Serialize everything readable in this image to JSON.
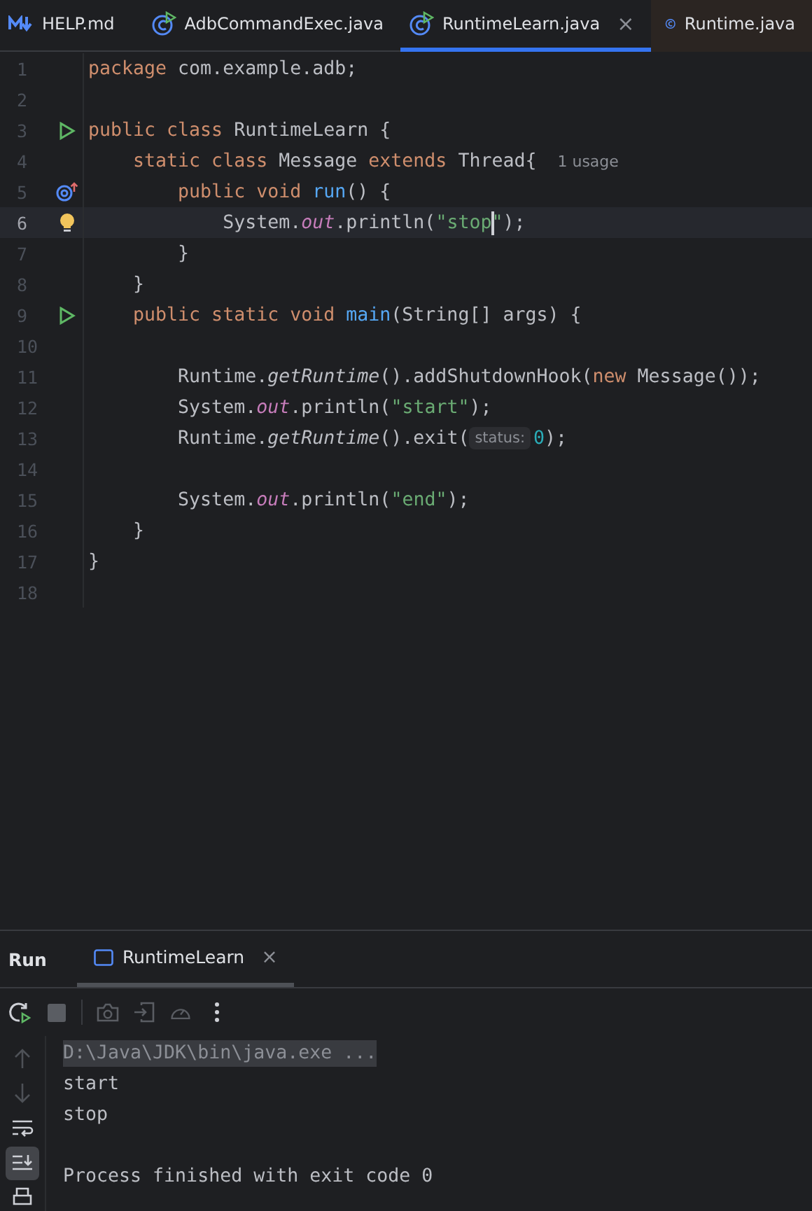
{
  "editor_tabs": [
    {
      "label": "HELP.md",
      "kind": "markdown",
      "selected": false
    },
    {
      "label": "AdbCommandExec.java",
      "kind": "runnable-class",
      "selected": false
    },
    {
      "label": "RuntimeLearn.java",
      "kind": "runnable-class",
      "selected": true,
      "close": "×"
    },
    {
      "label": "Runtime.java",
      "kind": "class",
      "selected": false
    }
  ],
  "code_lines": [
    {
      "number": "1",
      "current": false,
      "parts": [
        {
          "kind": "code",
          "tokens": [
            {
              "kind": "kw",
              "text": "package "
            },
            {
              "kind": "plain",
              "text": "com.example.adb;"
            }
          ]
        }
      ]
    },
    {
      "number": "2",
      "current": false
    },
    {
      "number": "3",
      "current": false,
      "gutter": {
        "kind": "run"
      },
      "parts": [
        {
          "kind": "code",
          "tokens": [
            {
              "kind": "kw",
              "text": "public class "
            },
            {
              "kind": "plain",
              "text": "RuntimeLearn {"
            }
          ]
        }
      ]
    },
    {
      "number": "4",
      "current": false,
      "parts": [
        {
          "kind": "code",
          "tokens": [
            {
              "kind": "kw",
              "text": "    static class "
            },
            {
              "kind": "plain",
              "text": "Message "
            },
            {
              "kind": "kw",
              "text": "extends "
            },
            {
              "kind": "plain",
              "text": "Thread{"
            }
          ]
        },
        {
          "kind": "usage",
          "text": "1 usage"
        }
      ]
    },
    {
      "number": "5",
      "current": false,
      "gutter": {
        "kind": "override"
      },
      "parts": [
        {
          "kind": "code",
          "tokens": [
            {
              "kind": "kw",
              "text": "        public void "
            },
            {
              "kind": "method",
              "text": "run"
            },
            {
              "kind": "plain",
              "text": "() {"
            }
          ]
        }
      ]
    },
    {
      "number": "6",
      "current": true,
      "gutter": {
        "kind": "bulb"
      },
      "parts": [
        {
          "kind": "code",
          "tokens": [
            {
              "kind": "plain",
              "text": "            System."
            },
            {
              "kind": "field",
              "text": "out"
            },
            {
              "kind": "plain",
              "text": ".println("
            },
            {
              "kind": "string",
              "text": "\"stop"
            },
            {
              "kind": "caret"
            },
            {
              "kind": "string",
              "text": "\""
            },
            {
              "kind": "plain",
              "text": ");"
            }
          ]
        }
      ]
    },
    {
      "number": "7",
      "current": false,
      "parts": [
        {
          "kind": "code",
          "tokens": [
            {
              "kind": "plain",
              "text": "        }"
            }
          ]
        }
      ]
    },
    {
      "number": "8",
      "current": false,
      "parts": [
        {
          "kind": "code",
          "tokens": [
            {
              "kind": "plain",
              "text": "    }"
            }
          ]
        }
      ]
    },
    {
      "number": "9",
      "current": false,
      "gutter": {
        "kind": "run"
      },
      "parts": [
        {
          "kind": "code",
          "tokens": [
            {
              "kind": "kw",
              "text": "    public static void "
            },
            {
              "kind": "method",
              "text": "main"
            },
            {
              "kind": "plain",
              "text": "(String[] args) {"
            }
          ]
        }
      ]
    },
    {
      "number": "10",
      "current": false
    },
    {
      "number": "11",
      "current": false,
      "parts": [
        {
          "kind": "code",
          "tokens": [
            {
              "kind": "plain",
              "text": "        Runtime."
            },
            {
              "kind": "static",
              "text": "getRuntime"
            },
            {
              "kind": "plain",
              "text": "().addShutdownHook("
            },
            {
              "kind": "kw",
              "text": "new "
            },
            {
              "kind": "plain",
              "text": "Message());"
            }
          ]
        }
      ]
    },
    {
      "number": "12",
      "current": false,
      "parts": [
        {
          "kind": "code",
          "tokens": [
            {
              "kind": "plain",
              "text": "        System."
            },
            {
              "kind": "field",
              "text": "out"
            },
            {
              "kind": "plain",
              "text": ".println("
            },
            {
              "kind": "string",
              "text": "\"start\""
            },
            {
              "kind": "plain",
              "text": ");"
            }
          ]
        }
      ]
    },
    {
      "number": "13",
      "current": false,
      "parts": [
        {
          "kind": "code",
          "tokens": [
            {
              "kind": "plain",
              "text": "        Runtime."
            },
            {
              "kind": "static",
              "text": "getRuntime"
            },
            {
              "kind": "plain",
              "text": "().exit("
            }
          ]
        },
        {
          "kind": "hint",
          "text": "status:"
        },
        {
          "kind": "code",
          "tokens": [
            {
              "kind": "number",
              "text": "0"
            },
            {
              "kind": "plain",
              "text": ");"
            }
          ]
        }
      ]
    },
    {
      "number": "14",
      "current": false
    },
    {
      "number": "15",
      "current": false,
      "parts": [
        {
          "kind": "code",
          "tokens": [
            {
              "kind": "plain",
              "text": "        System."
            },
            {
              "kind": "field",
              "text": "out"
            },
            {
              "kind": "plain",
              "text": ".println("
            },
            {
              "kind": "string",
              "text": "\"end\""
            },
            {
              "kind": "plain",
              "text": ");"
            }
          ]
        }
      ]
    },
    {
      "number": "16",
      "current": false,
      "parts": [
        {
          "kind": "code",
          "tokens": [
            {
              "kind": "plain",
              "text": "    }"
            }
          ]
        }
      ]
    },
    {
      "number": "17",
      "current": false,
      "parts": [
        {
          "kind": "code",
          "tokens": [
            {
              "kind": "plain",
              "text": "}"
            }
          ]
        }
      ]
    },
    {
      "number": "18",
      "current": false
    }
  ],
  "run_panel": {
    "title": "Run",
    "tabs": [
      {
        "label": "RuntimeLearn",
        "selected": true,
        "close": "×"
      }
    ],
    "toolbar": [
      {
        "kind": "rerun",
        "disabled": false
      },
      {
        "kind": "stop",
        "disabled": true
      },
      {
        "kind": "separator"
      },
      {
        "kind": "camera",
        "disabled": true
      },
      {
        "kind": "exit",
        "disabled": true
      },
      {
        "kind": "gauge",
        "disabled": true
      },
      {
        "kind": "more",
        "disabled": false
      }
    ],
    "side_tools": [
      {
        "kind": "up",
        "selected": false,
        "disabled": true
      },
      {
        "kind": "down",
        "selected": false,
        "disabled": true
      },
      {
        "kind": "wrap",
        "selected": false,
        "disabled": false
      },
      {
        "kind": "scroll-end",
        "selected": true,
        "disabled": false
      },
      {
        "kind": "print",
        "selected": false,
        "disabled": false
      }
    ],
    "console": [
      {
        "kind": "command",
        "text": "D:\\Java\\JDK\\bin\\java.exe ..."
      },
      {
        "kind": "output",
        "text": "start"
      },
      {
        "kind": "output",
        "text": "stop"
      },
      {
        "kind": "blank"
      },
      {
        "kind": "output",
        "text": "Process finished with exit code 0"
      }
    ]
  }
}
